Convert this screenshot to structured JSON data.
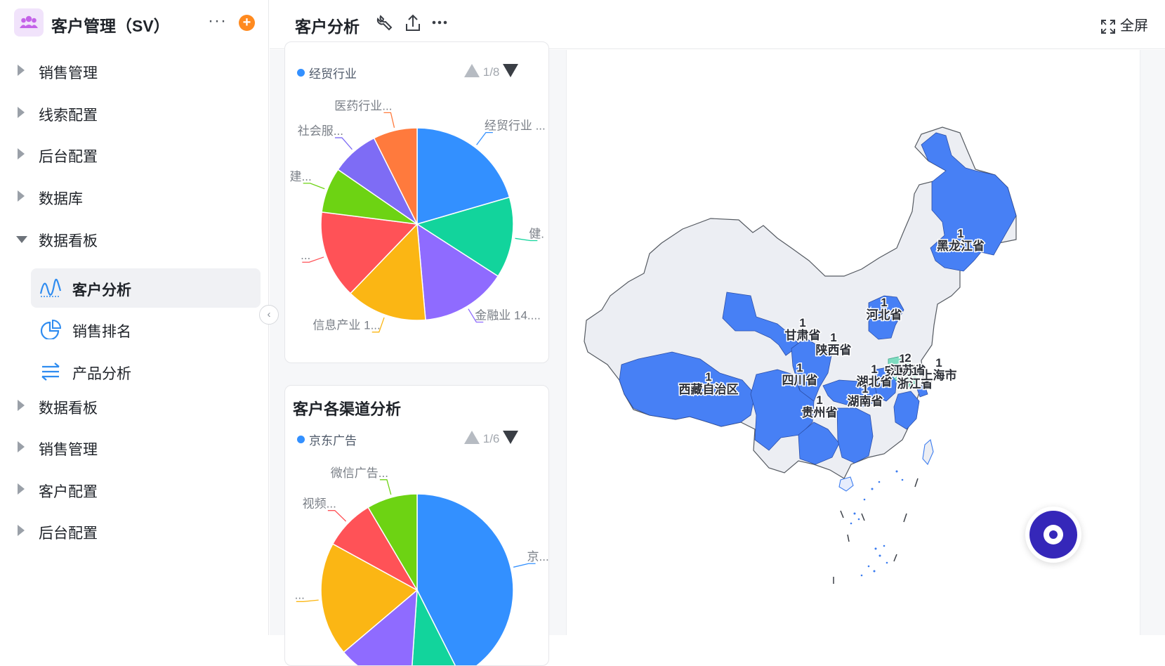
{
  "app": {
    "title": "客户管理（SV）",
    "more_label": "···",
    "add_label": "+"
  },
  "sidebar": {
    "items": [
      {
        "label": "销售管理",
        "expanded": false
      },
      {
        "label": "线索配置",
        "expanded": false
      },
      {
        "label": "后台配置",
        "expanded": false
      },
      {
        "label": "数据库",
        "expanded": false
      },
      {
        "label": "数据看板",
        "expanded": true
      },
      {
        "label": "数据看板",
        "expanded": false
      },
      {
        "label": "销售管理",
        "expanded": false
      },
      {
        "label": "客户配置",
        "expanded": false
      },
      {
        "label": "后台配置",
        "expanded": false
      }
    ],
    "subitems": [
      {
        "label": "客户分析",
        "icon": "line-chart-icon",
        "active": true
      },
      {
        "label": "销售排名",
        "icon": "pie-chart-icon",
        "active": false
      },
      {
        "label": "产品分析",
        "icon": "transfer-icon",
        "active": false
      }
    ],
    "collapse_label": "‹"
  },
  "header": {
    "title": "客户分析",
    "fullscreen_label": "全屏"
  },
  "chart_data": [
    {
      "type": "pie",
      "title": "",
      "legend": {
        "active": "经贸行业",
        "page": "1/8"
      },
      "slices": [
        {
          "label": "经贸行业 ...",
          "value": 20.5,
          "color": "#3390ff"
        },
        {
          "label": "健.",
          "value": 13.6,
          "color": "#12d49c"
        },
        {
          "label": "金融业 14....",
          "value": 14.5,
          "color": "#8f6bff"
        },
        {
          "label": "信息产业 1...",
          "value": 13.6,
          "color": "#fbb614"
        },
        {
          "label": "...",
          "value": 14.8,
          "color": "#ff5257"
        },
        {
          "label": "建...",
          "value": 7.6,
          "color": "#6dd313"
        },
        {
          "label": "社会服...",
          "value": 8.0,
          "color": "#7e6cf5"
        },
        {
          "label": "医药行业...",
          "value": 7.4,
          "color": "#ff7a3d"
        }
      ]
    },
    {
      "type": "pie",
      "title": "客户各渠道分析",
      "legend": {
        "active": "京东广告",
        "page": "1/6"
      },
      "slices": [
        {
          "label": "京...",
          "value": 40.0,
          "color": "#3390ff"
        },
        {
          "label": "",
          "value": 8.0,
          "color": "#12d49c"
        },
        {
          "label": "",
          "value": 12.0,
          "color": "#8f6bff"
        },
        {
          "label": "...",
          "value": 18.0,
          "color": "#fbb614"
        },
        {
          "label": "视频...",
          "value": 8.0,
          "color": "#ff5257"
        },
        {
          "label": "微信广告...",
          "value": 8.0,
          "color": "#6dd313"
        }
      ]
    },
    {
      "type": "map",
      "title": "",
      "regions": [
        {
          "name": "黑龙江省",
          "value": 1
        },
        {
          "name": "河北省",
          "value": 1
        },
        {
          "name": "甘肃省",
          "value": 1
        },
        {
          "name": "陕西省",
          "value": 1
        },
        {
          "name": "西藏自治区",
          "value": 1
        },
        {
          "name": "四川省",
          "value": 1
        },
        {
          "name": "贵州省",
          "value": 1
        },
        {
          "name": "湖北省",
          "value": 1
        },
        {
          "name": "湖南省",
          "value": 1
        },
        {
          "name": "安徽省",
          "value": 1
        },
        {
          "name": "江苏省",
          "value": 2
        },
        {
          "name": "浙江省",
          "value": 1
        },
        {
          "name": "上海市",
          "value": 1
        }
      ],
      "colors": {
        "filled": "#4780f5",
        "highlight": "#7fdcc0",
        "empty": "#eceef3"
      }
    }
  ]
}
